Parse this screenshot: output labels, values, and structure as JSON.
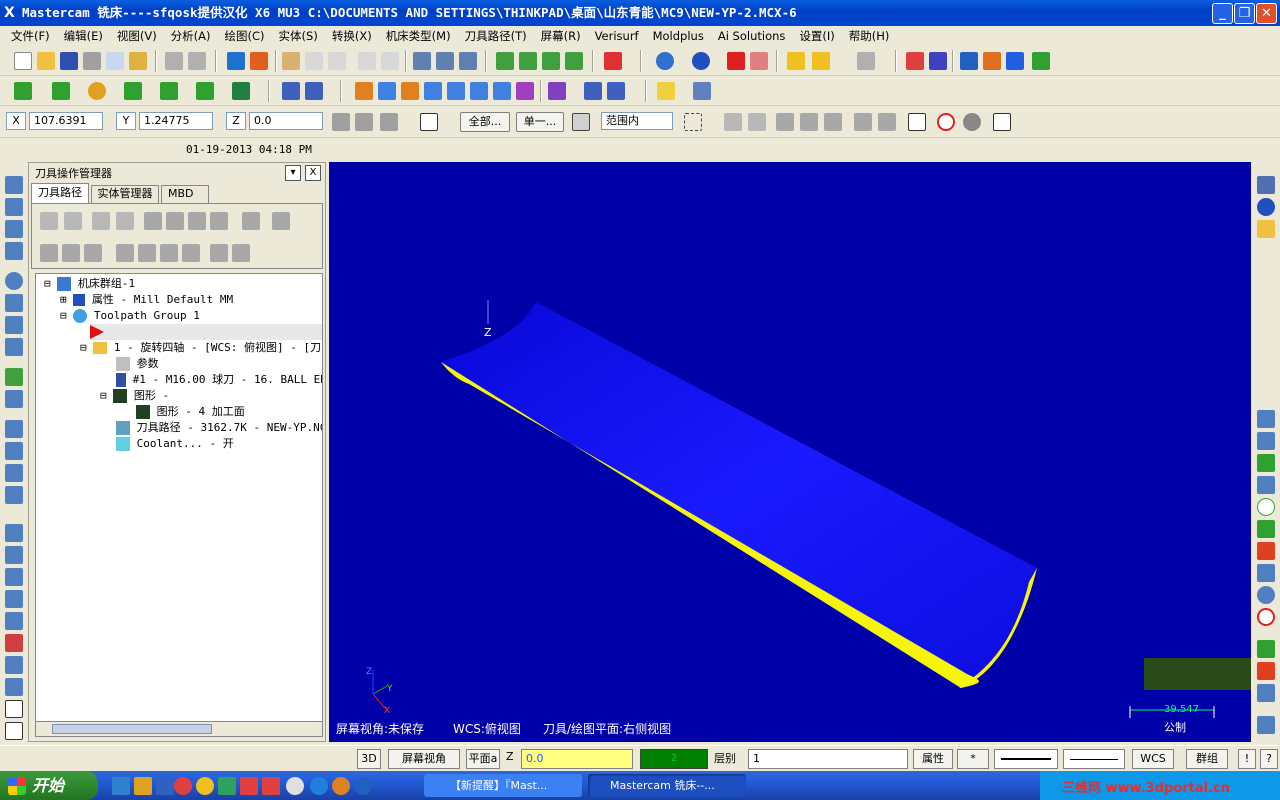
{
  "window": {
    "title": "Mastercam 铣床----sfqosk提供汉化 X6 MU3  C:\\DOCUMENTS AND SETTINGS\\THINKPAD\\桌面\\山东青能\\MC9\\NEW-YP-2.MCX-6",
    "icon": "mastercam-x-icon",
    "minimize": "_",
    "restore": "❐",
    "close": "✕"
  },
  "menu": [
    "文件(F)",
    "编辑(E)",
    "视图(V)",
    "分析(A)",
    "绘图(C)",
    "实体(S)",
    "转换(X)",
    "机床类型(M)",
    "刀具路径(T)",
    "屏幕(R)",
    "Verisurf",
    "Moldplus",
    "Ai Solutions",
    "设置(I)",
    "帮助(H)"
  ],
  "coords": {
    "x_label": "X",
    "x_value": "107.6391",
    "y_label": "Y",
    "y_value": "1.24775",
    "z_label": "Z",
    "z_value": "0.0",
    "all_label": "全部...",
    "single_label": "单一...",
    "range_value": "范围内"
  },
  "date": "01-19-2013 04:18 PM",
  "panel": {
    "title": "刀具操作管理器",
    "dropdown": "▾",
    "close": "X",
    "tabs": [
      "刀具路径",
      "实体管理器",
      "MBD"
    ],
    "tree": [
      {
        "text": "机床群组-1"
      },
      {
        "text": "属性 - Mill Default MM"
      },
      {
        "text": "Toolpath Group 1"
      },
      {
        "text": ""
      },
      {
        "text": "1 - 旋转四轴 - [WCS: 俯视图] - [刀"
      },
      {
        "text": "参数"
      },
      {
        "text": "#1 - M16.00 球刀 -  16. BALL EN"
      },
      {
        "text": "图形 -"
      },
      {
        "text": "图形 - 4 加工面"
      },
      {
        "text": "刀具路径 - 3162.7K - NEW-YP.NC"
      },
      {
        "text": "Coolant... - 开"
      }
    ]
  },
  "viewport": {
    "background": "#0000a8",
    "surface_color": "#1414f0",
    "edge_color": "#f5f50a",
    "z_axis_label": "Z",
    "triad": {
      "z": "Z",
      "y": "Y",
      "x": "X"
    },
    "status": {
      "screen_view": "屏幕视角:未保存",
      "wcs": "WCS:俯视图",
      "tool_plane": "刀具/绘图平面:右侧视图"
    },
    "scale_value": "39.547",
    "scale_unit": "公制"
  },
  "statusbar": {
    "btn_3d": "3D",
    "screen_view": "屏幕视角",
    "plane": "平面a",
    "z_label": "Z",
    "z_value": "0.0",
    "color_value": "2",
    "level_label": "层别",
    "level_value": "1",
    "attr": "属性",
    "star": "*",
    "wcs": "WCS",
    "group": "群组",
    "excl": "!",
    "help": "?"
  },
  "taskbar": {
    "start": "开始",
    "tasks": [
      "【新提醒】『Mast...",
      "Mastercam 铣床--..."
    ],
    "watermark": "三维网 www.3dportal.cn"
  }
}
